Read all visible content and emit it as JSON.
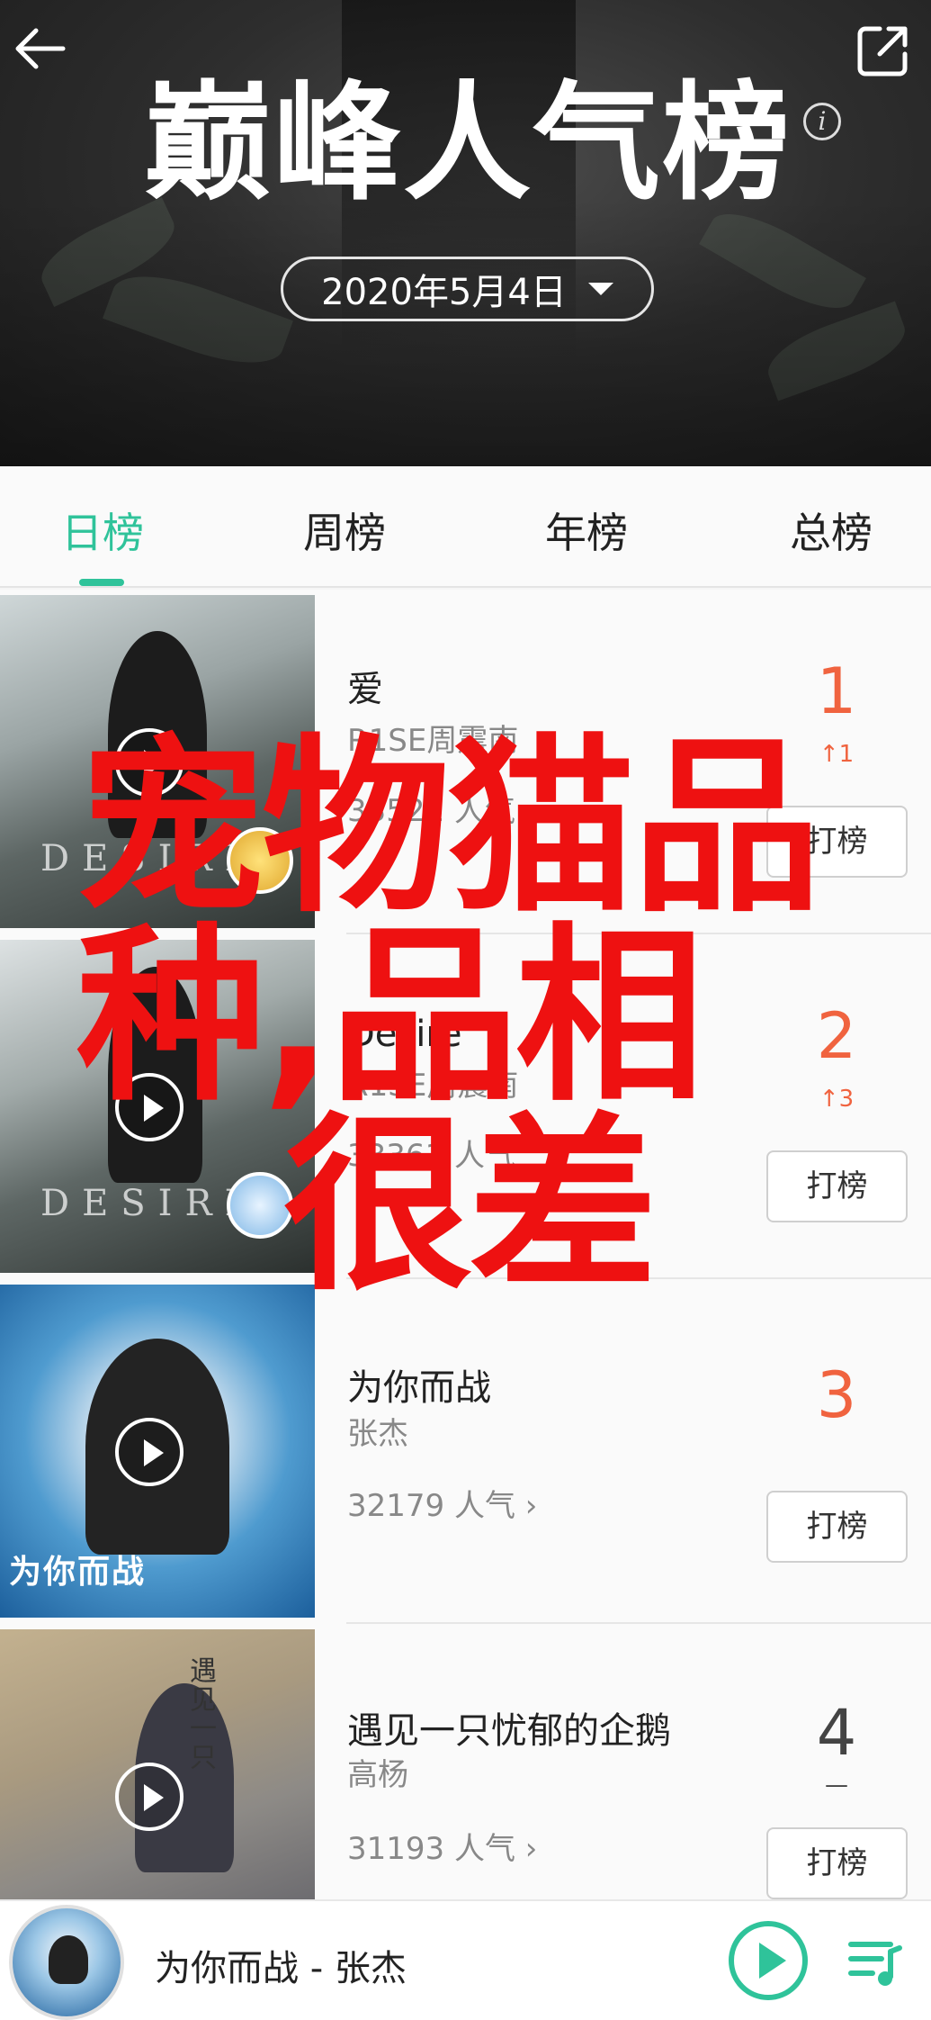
{
  "header": {
    "title": "巅峰人气榜",
    "date": "2020年5月4日",
    "info_symbol": "i"
  },
  "tabs": [
    {
      "label": "日榜",
      "active": true
    },
    {
      "label": "周榜",
      "active": false
    },
    {
      "label": "年榜",
      "active": false
    },
    {
      "label": "总榜",
      "active": false
    }
  ],
  "songs": [
    {
      "title": "爱",
      "artist": "R1SE周震南",
      "popularity": "33521 人气",
      "rank": "1",
      "trend": "↑1",
      "vote_label": "打榜",
      "cover_text": "DESIRE"
    },
    {
      "title": "Desire",
      "artist": "R1SE周震南",
      "popularity": "33361 人气",
      "rank": "2",
      "trend": "↑3",
      "vote_label": "打榜",
      "cover_text": "DESIRE"
    },
    {
      "title": "为你而战",
      "artist": "张杰",
      "popularity": "32179 人气",
      "rank": "3",
      "trend": "",
      "vote_label": "打榜",
      "cover_text": "为你而战"
    },
    {
      "title": "遇见一只忧郁的企鹅",
      "artist": "高杨",
      "popularity": "31193 人气",
      "rank": "4",
      "trend": "—",
      "vote_label": "打榜",
      "cover_text": "遇见一只"
    }
  ],
  "watermark": {
    "line1": "宠物猫品",
    "line2": "种,品相",
    "line3": "很差"
  },
  "player": {
    "now_playing": "为你而战 - 张杰"
  },
  "colors": {
    "accent": "#2fc39a",
    "rank_red": "#f0633f",
    "watermark_red": "#ee1111"
  }
}
